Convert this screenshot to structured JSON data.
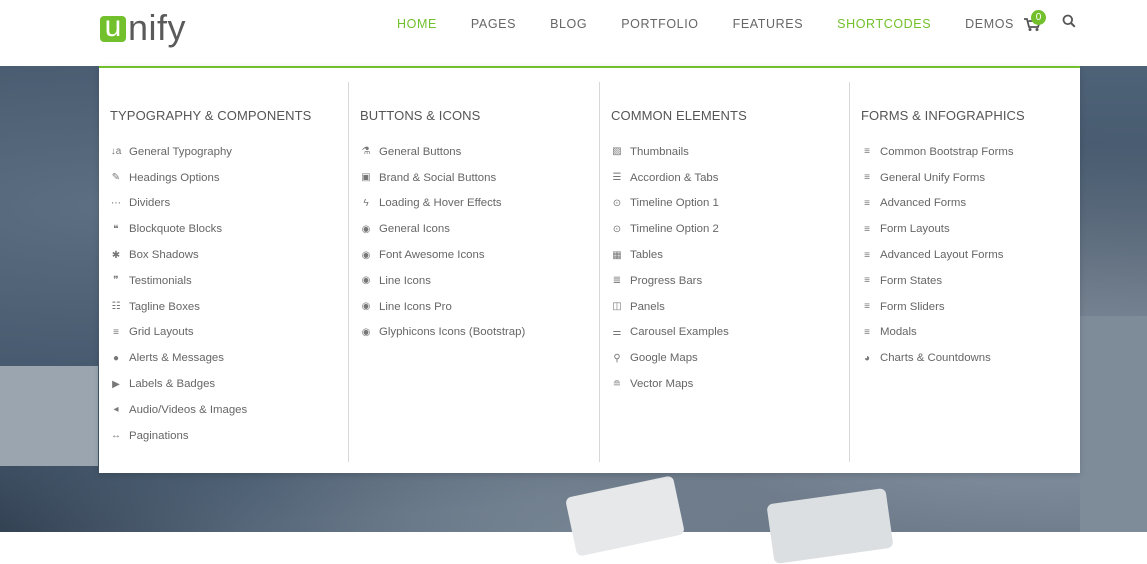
{
  "brand": {
    "logo_letter": "u",
    "logo_rest": "nify",
    "accent": "#72c02c"
  },
  "nav": {
    "items": [
      {
        "label": "HOME",
        "active": true
      },
      {
        "label": "PAGES",
        "active": false
      },
      {
        "label": "BLOG",
        "active": false
      },
      {
        "label": "PORTFOLIO",
        "active": false
      },
      {
        "label": "FEATURES",
        "active": false
      },
      {
        "label": "SHORTCODES",
        "active": true
      },
      {
        "label": "DEMOS",
        "active": false
      }
    ],
    "cart_count": "0"
  },
  "menu": {
    "columns": [
      {
        "title": "TYPOGRAPHY & COMPONENTS",
        "items": [
          {
            "label": "General Typography",
            "icon": "sort-icon",
            "glyph": "↓a"
          },
          {
            "label": "Headings Options",
            "icon": "magic-icon",
            "glyph": "✎"
          },
          {
            "label": "Dividers",
            "icon": "ellipsis-icon",
            "glyph": "⋯"
          },
          {
            "label": "Blockquote Blocks",
            "icon": "quote-icon",
            "glyph": "❝"
          },
          {
            "label": "Box Shadows",
            "icon": "asterisk-icon",
            "glyph": "✱"
          },
          {
            "label": "Testimonials",
            "icon": "comments-icon",
            "glyph": "❞"
          },
          {
            "label": "Tagline Boxes",
            "icon": "list-alt-icon",
            "glyph": "☷"
          },
          {
            "label": "Grid Layouts",
            "icon": "bars-icon",
            "glyph": "≡"
          },
          {
            "label": "Alerts & Messages",
            "icon": "comment-icon",
            "glyph": "●"
          },
          {
            "label": "Labels & Badges",
            "icon": "tags-icon",
            "glyph": "▶"
          },
          {
            "label": "Audio/Videos & Images",
            "icon": "volume-icon",
            "glyph": "◂"
          },
          {
            "label": "Paginations",
            "icon": "arrows-h-icon",
            "glyph": "↔"
          }
        ]
      },
      {
        "title": "BUTTONS & ICONS",
        "items": [
          {
            "label": "General Buttons",
            "icon": "flask-icon",
            "glyph": "⚗"
          },
          {
            "label": "Brand & Social Buttons",
            "icon": "html5-icon",
            "glyph": "▣"
          },
          {
            "label": "Loading & Hover Effects",
            "icon": "bolt-icon",
            "glyph": "ϟ"
          },
          {
            "label": "General Icons",
            "icon": "chevron-circle-icon",
            "glyph": "◉"
          },
          {
            "label": "Font Awesome Icons",
            "icon": "chevron-circle-icon",
            "glyph": "◉"
          },
          {
            "label": "Line Icons",
            "icon": "chevron-circle-icon",
            "glyph": "◉"
          },
          {
            "label": "Line Icons Pro",
            "icon": "chevron-circle-icon",
            "glyph": "◉"
          },
          {
            "label": "Glyphicons Icons (Bootstrap)",
            "icon": "chevron-circle-icon",
            "glyph": "◉"
          }
        ]
      },
      {
        "title": "COMMON ELEMENTS",
        "items": [
          {
            "label": "Thumbnails",
            "icon": "image-icon",
            "glyph": "▨"
          },
          {
            "label": "Accordion & Tabs",
            "icon": "list-ol-icon",
            "glyph": "☰"
          },
          {
            "label": "Timeline Option 1",
            "icon": "dot-circle-icon",
            "glyph": "⊙"
          },
          {
            "label": "Timeline Option 2",
            "icon": "dot-circle-icon",
            "glyph": "⊙"
          },
          {
            "label": "Tables",
            "icon": "table-icon",
            "glyph": "▦"
          },
          {
            "label": "Progress Bars",
            "icon": "align-left-icon",
            "glyph": "≣"
          },
          {
            "label": "Panels",
            "icon": "columns-icon",
            "glyph": "◫"
          },
          {
            "label": "Carousel Examples",
            "icon": "sliders-icon",
            "glyph": "⚌"
          },
          {
            "label": "Google Maps",
            "icon": "map-marker-icon",
            "glyph": "⚲"
          },
          {
            "label": "Vector Maps",
            "icon": "align-center-icon",
            "glyph": "≘"
          }
        ]
      },
      {
        "title": "FORMS & INFOGRAPHICS",
        "items": [
          {
            "label": "Common Bootstrap Forms",
            "icon": "bars-icon",
            "glyph": "≡"
          },
          {
            "label": "General Unify Forms",
            "icon": "bars-icon",
            "glyph": "≡"
          },
          {
            "label": "Advanced Forms",
            "icon": "bars-icon",
            "glyph": "≡"
          },
          {
            "label": "Form Layouts",
            "icon": "bars-icon",
            "glyph": "≡"
          },
          {
            "label": "Advanced Layout Forms",
            "icon": "bars-icon",
            "glyph": "≡"
          },
          {
            "label": "Form States",
            "icon": "bars-icon",
            "glyph": "≡"
          },
          {
            "label": "Form Sliders",
            "icon": "bars-icon",
            "glyph": "≡"
          },
          {
            "label": "Modals",
            "icon": "bars-icon",
            "glyph": "≡"
          },
          {
            "label": "Charts & Countdowns",
            "icon": "pie-chart-icon",
            "glyph": "◕"
          }
        ]
      }
    ]
  }
}
